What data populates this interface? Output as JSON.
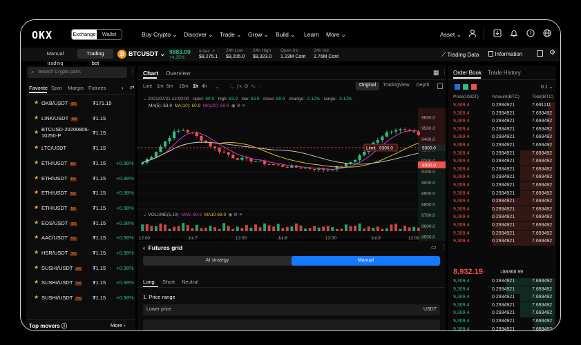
{
  "nav": {
    "logo": "OKX",
    "exchange_label": "Exchange",
    "wallet_label": "Wallet",
    "menu": [
      "Buy Crypto ⌄",
      "Discover ⌄",
      "Trade ⌄",
      "Grow ⌄",
      "Build ⌄",
      "Learn",
      "More ⌄"
    ],
    "asset_label": "Asset ⌄"
  },
  "subbar": {
    "manual_trading": "Manual trading",
    "trading_bot": "Trading bot",
    "pair": "BTCUSDT ⌄",
    "price": "9883.09",
    "change": "+4.25%",
    "stats": [
      {
        "label": "Index ↗",
        "value": "$9,275.1"
      },
      {
        "label": "24h Low",
        "value": "$9,205.0"
      },
      {
        "label": "24h High",
        "value": "$9,323.0"
      },
      {
        "label": "Open Int.",
        "value": "1.23M Cont"
      },
      {
        "label": "24h Vol",
        "value": "2.76M Cont"
      }
    ],
    "trading_data": "Trading Data",
    "information": "Information"
  },
  "pairs": {
    "search_placeholder": "Search Crypto pairs",
    "tabs": [
      "Favorite",
      "Spot",
      "Margin",
      "Futures"
    ],
    "rows": [
      {
        "name": "OKB/USDT",
        "badge": "5X",
        "price": "₮171.15",
        "change": ""
      },
      {
        "name": "LINK/USDT",
        "badge": "5X",
        "price": "₮1.15",
        "change": ""
      },
      {
        "name": "BTCUSD-20200806-",
        "name2": "10250-P",
        "badge": "",
        "price": "₮1.15",
        "change": ""
      },
      {
        "name": "LTC/USDT",
        "badge": "",
        "price": "₮1.15",
        "change": ""
      },
      {
        "name": "ETH/USDT",
        "badge": "5X",
        "price": "₮1.15",
        "change": "+0.98%"
      },
      {
        "name": "ETH/USDT",
        "badge": "5X",
        "price": "₮1.15",
        "change": "+0.98%"
      },
      {
        "name": "ETH/USDT",
        "badge": "5X",
        "price": "₮1.15",
        "change": "+0.98%"
      },
      {
        "name": "ETH/USDT",
        "badge": "5X",
        "price": "₮1.15",
        "change": "+0.98%"
      },
      {
        "name": "EOS/USDT",
        "badge": "5X",
        "price": "₮1.15",
        "change": "+0.98%"
      },
      {
        "name": "AAC/USDT",
        "badge": "5X",
        "price": "₮1.15",
        "change": "+0.98%"
      },
      {
        "name": "HSR/USDT",
        "badge": "5X",
        "price": "₮1.15",
        "change": "+0.98%"
      },
      {
        "name": "SUSHI/USDT",
        "badge": "5X",
        "price": "₮1.15",
        "change": "+0.98%"
      },
      {
        "name": "SUSHI/USDT",
        "badge": "5X",
        "price": "₮1.15",
        "change": "+0.98%"
      },
      {
        "name": "SUSHI/USDT",
        "badge": "5X",
        "price": "₮1.15",
        "change": "+0.98%"
      }
    ],
    "top_movers": "Top movers ⓘ",
    "more": "More"
  },
  "chart": {
    "tabs": [
      "Chart",
      "Overview"
    ],
    "intervals": [
      "Line",
      "1m",
      "5m",
      "15m",
      "1h",
      "4h"
    ],
    "views": [
      "Original",
      "TradingView",
      "Depth"
    ],
    "info": {
      "date": "2021/07/21 12:00:00",
      "open_label": "open:",
      "open": "69.9",
      "high_label": "high:",
      "high": "63.9",
      "low_label": "low:",
      "low": "63.9",
      "close_label": "close:",
      "close": "69.9",
      "change_label": "change:",
      "change": "-0.12%",
      "range_label": "range:",
      "range": "-0.12%"
    },
    "ma": {
      "ma5": "MA(5): 63.9",
      "ma10": "MA(10): 60.9",
      "ma20": "MA(20): 69.9"
    },
    "volume": {
      "label": "VOLUME(5,10)",
      "ma5": "MA5: 60.9",
      "ma10": "MA10 69.9"
    },
    "limit_label": "Limit",
    "limit_value": "9300.0",
    "tag_price_1": "9300.0",
    "tag_price_2": "9300.0",
    "price_axis": [
      "9600.0",
      "9500.0",
      "9400.0",
      "9300.0",
      "9200.0",
      "9100.0",
      "9000.0",
      "8900.0",
      "8800.0",
      "8700.0",
      "8600.0",
      "8500.0"
    ],
    "time_axis": [
      "12:00",
      "Jul.7",
      "12:00",
      "Jul.8",
      "12:00",
      "Jul.9",
      "12:00"
    ],
    "colors": {
      "up": "#2ebd85",
      "down": "#f0514a",
      "ma5": "#c0c0c0",
      "ma10": "#d4c02a",
      "ma20": "#c040c0"
    }
  },
  "grid": {
    "title": "Futures grid",
    "ai_strategy": "AI strategy",
    "manual": "Manual",
    "dir_tabs": [
      "Long",
      "Short",
      "Neutral"
    ],
    "price_range": "1. Price range",
    "lower_price": "Lower price",
    "unit": "USDT"
  },
  "orderbook": {
    "tabs": [
      "Order Book",
      "Trade History"
    ],
    "step": "0.1 ⌄",
    "headers": [
      "Price(USDT)",
      "Amount(BTC)",
      "Total(BTC)"
    ],
    "asks": [
      [
        "9,309.4",
        "0.2934921",
        "7.691111"
      ],
      [
        "9,309.4",
        "0.2934921",
        "7.693492"
      ],
      [
        "9,309.4",
        "0.2934921",
        "7.693492"
      ],
      [
        "9,309.4",
        "0.2934921",
        "7.693492"
      ],
      [
        "9,309.4",
        "0.2934921",
        "7.693492"
      ],
      [
        "9,309.4",
        "0.2934921",
        "7.693492"
      ],
      [
        "9,309.4",
        "0.2934921",
        "7.693492"
      ],
      [
        "9,309.4",
        "0.2934921",
        "7.693492"
      ],
      [
        "9,309.4",
        "0.2934921",
        "7.693492"
      ],
      [
        "9,309.4",
        "0.2934921",
        "7.693492"
      ],
      [
        "9,309.4",
        "0.2934921",
        "7.693492"
      ],
      [
        "9,309.4",
        "0.2934921",
        "7.693492"
      ],
      [
        "9,309.4",
        "0.2934921",
        "7.693492"
      ],
      [
        "9,309.4",
        "0.2934921",
        "7.693492"
      ],
      [
        "9,309.4",
        "0.2934921",
        "7.693492"
      ],
      [
        "9,309.4",
        "0.2934921",
        "7.693492"
      ],
      [
        "9,309.4",
        "0.2934921",
        "7.693492"
      ],
      [
        "9,309.4",
        "0.2934921",
        "7.693492"
      ]
    ],
    "last_price": "8,932.19",
    "last_arrow": "↑",
    "mark_price": "≈$9368.99",
    "bids": [
      [
        "9,309.4",
        "0.2934921",
        "7.693492"
      ],
      [
        "9,309.4",
        "0.2934921",
        "7.693492"
      ],
      [
        "9,309.4",
        "0.2934921",
        "7.693492"
      ],
      [
        "9,309.4",
        "0.2934921",
        "7.693492"
      ],
      [
        "9,309.4",
        "0.2934921",
        "7.693492"
      ],
      [
        "9,309.4",
        "0.2934921",
        "7.693492"
      ],
      [
        "9,309.4",
        "0.2934921",
        "7.693492"
      ],
      [
        "9,309.4",
        "0.2934921",
        "7.693492"
      ]
    ]
  }
}
